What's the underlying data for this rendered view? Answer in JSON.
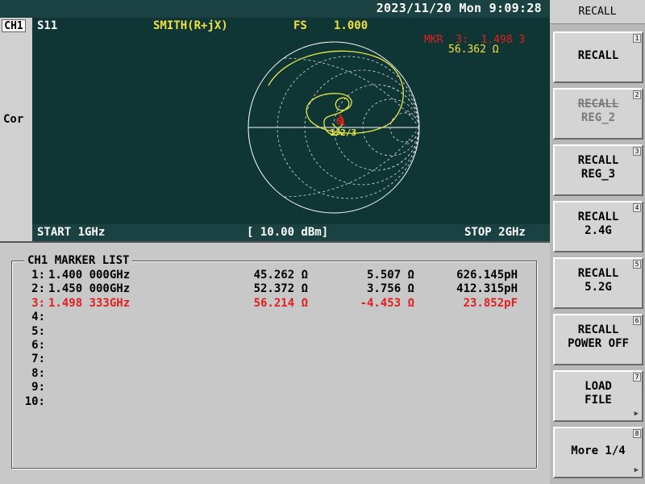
{
  "status": {
    "datetime": "2023/11/20 Mon   9:09:28"
  },
  "trace": {
    "channel": "CH1",
    "param": "S11",
    "format": "SMITH(R+jX)",
    "fs_label": "FS",
    "fs_value": "1.000",
    "side_label": "Cor",
    "marker_readout": "MKR  3:  1.498 3",
    "marker_value": "56.362 Ω",
    "start": "START 1GHz",
    "power": "[ 10.00 dBm]",
    "stop": "STOP 2GHz",
    "marker_id": "1/2/3"
  },
  "marker_list": {
    "title": "CH1 MARKER LIST",
    "rows": [
      {
        "idx": "1:",
        "freq": "1.400 000GHz",
        "r": "45.262 Ω",
        "x": "5.507 Ω",
        "lc": "626.145pH",
        "active": false
      },
      {
        "idx": "2:",
        "freq": "1.450 000GHz",
        "r": "52.372 Ω",
        "x": "3.756 Ω",
        "lc": "412.315pH",
        "active": false
      },
      {
        "idx": "3:",
        "freq": "1.498 333GHz",
        "r": "56.214 Ω",
        "x": "-4.453 Ω",
        "lc": "23.852pF",
        "active": true
      },
      {
        "idx": "4:",
        "freq": "",
        "r": "",
        "x": "",
        "lc": "",
        "active": false
      },
      {
        "idx": "5:",
        "freq": "",
        "r": "",
        "x": "",
        "lc": "",
        "active": false
      },
      {
        "idx": "6:",
        "freq": "",
        "r": "",
        "x": "",
        "lc": "",
        "active": false
      },
      {
        "idx": "7:",
        "freq": "",
        "r": "",
        "x": "",
        "lc": "",
        "active": false
      },
      {
        "idx": "8:",
        "freq": "",
        "r": "",
        "x": "",
        "lc": "",
        "active": false
      },
      {
        "idx": "9:",
        "freq": "",
        "r": "",
        "x": "",
        "lc": "",
        "active": false
      },
      {
        "idx": "10:",
        "freq": "",
        "r": "",
        "x": "",
        "lc": "",
        "active": false
      }
    ]
  },
  "menu": {
    "title": "RECALL",
    "keys": [
      {
        "line1": "RECALL",
        "line2": "",
        "num": "1",
        "disabled": false,
        "arrow": ""
      },
      {
        "line1": "RECALL",
        "line2": "REG_2",
        "num": "2",
        "disabled": true,
        "arrow": ""
      },
      {
        "line1": "RECALL",
        "line2": "REG_3",
        "num": "3",
        "disabled": false,
        "arrow": ""
      },
      {
        "line1": "RECALL",
        "line2": "2.4G",
        "num": "4",
        "disabled": false,
        "arrow": ""
      },
      {
        "line1": "RECALL",
        "line2": "5.2G",
        "num": "5",
        "disabled": false,
        "arrow": ""
      },
      {
        "line1": "RECALL",
        "line2": "POWER OFF",
        "num": "6",
        "disabled": false,
        "arrow": ""
      },
      {
        "line1": "LOAD",
        "line2": "FILE",
        "num": "7",
        "disabled": false,
        "arrow": "▶"
      },
      {
        "line1": "More 1/4",
        "line2": "",
        "num": "8",
        "disabled": false,
        "arrow": "▶"
      }
    ]
  },
  "colors": {
    "trace": "#e8e84a",
    "active_marker": "#e02020",
    "grid": "#ffffff",
    "header_yellow": "#f0e040",
    "screen_bg": "#0f3535"
  }
}
